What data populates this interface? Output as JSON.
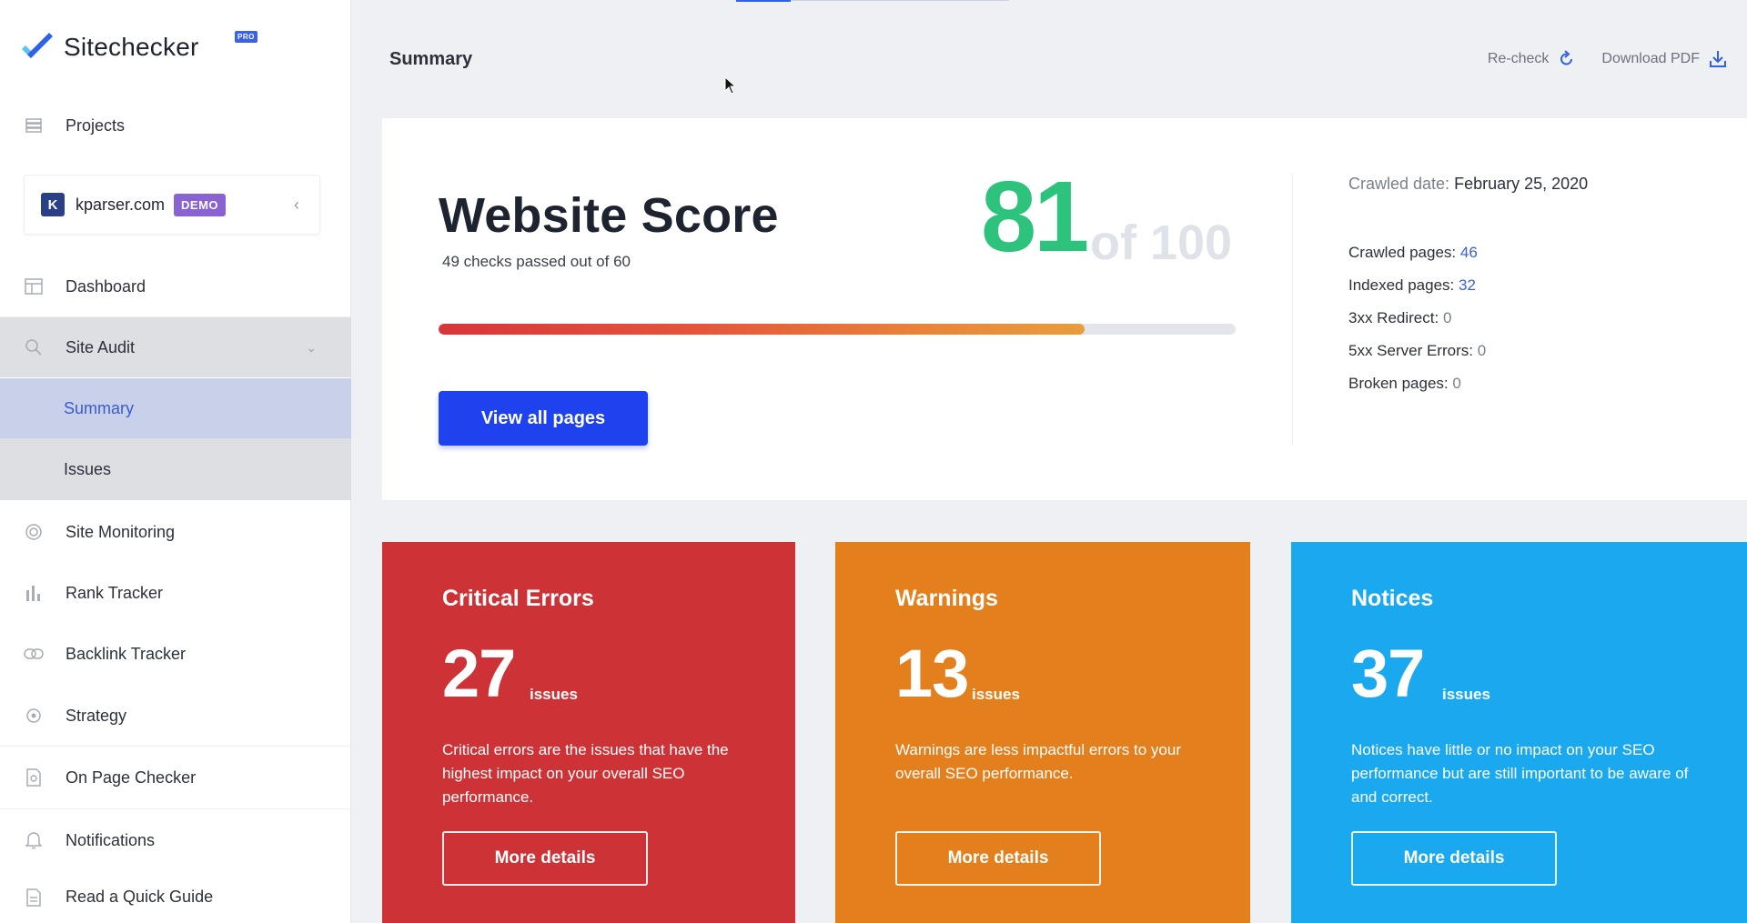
{
  "brand": {
    "name": "Sitechecker",
    "badge": "PRO",
    "accent": "#2f62e8"
  },
  "sidebar": {
    "projects_label": "Projects",
    "project": {
      "initial": "K",
      "name": "kparser.com",
      "badge": "DEMO"
    },
    "items": [
      {
        "label": "Dashboard",
        "icon": "dashboard-icon"
      },
      {
        "label": "Site Audit",
        "icon": "search-icon"
      },
      {
        "label": "Summary"
      },
      {
        "label": "Issues"
      },
      {
        "label": "Site Monitoring",
        "icon": "monitoring-icon"
      },
      {
        "label": "Rank Tracker",
        "icon": "bar-chart-icon"
      },
      {
        "label": "Backlink Tracker",
        "icon": "link-icon"
      },
      {
        "label": "Strategy",
        "icon": "target-icon"
      },
      {
        "label": "On Page Checker",
        "icon": "page-check-icon"
      },
      {
        "label": "Notifications",
        "icon": "bell-icon"
      },
      {
        "label": "Read a Quick Guide",
        "icon": "document-icon"
      }
    ]
  },
  "header": {
    "title": "Summary",
    "recheck": "Re-check",
    "download": "Download PDF"
  },
  "score": {
    "title": "Website Score",
    "subtitle": "49 checks passed out of 60",
    "value": "81",
    "of": "of 100",
    "progress_percent": 81,
    "button": "View all pages",
    "crawled_label": "Crawled date:",
    "crawled_date": "February 25, 2020",
    "stats": {
      "crawled_pages_label": "Crawled pages:",
      "crawled_pages": "46",
      "indexed_pages_label": "Indexed pages:",
      "indexed_pages": "32",
      "redirect_label": "3xx Redirect:",
      "redirect": "0",
      "server_errors_label": "5xx Server Errors:",
      "server_errors": "0",
      "broken_label": "Broken pages:",
      "broken": "0"
    }
  },
  "issues": {
    "critical": {
      "title": "Critical Errors",
      "count": "27",
      "unit": "issues",
      "desc": "Critical errors are the issues that have the highest impact on your overall SEO performance.",
      "button": "More details",
      "color": "#cd3336"
    },
    "warnings": {
      "title": "Warnings",
      "count": "13",
      "unit": "issues",
      "desc": "Warnings are less impactful errors to your overall SEO performance.",
      "button": "More details",
      "color": "#e37f1c"
    },
    "notices": {
      "title": "Notices",
      "count": "37",
      "unit": "issues",
      "desc": "Notices have little or no impact on your SEO performance but are still important to be aware of and correct.",
      "button": "More details",
      "color": "#1aa9ef"
    }
  }
}
